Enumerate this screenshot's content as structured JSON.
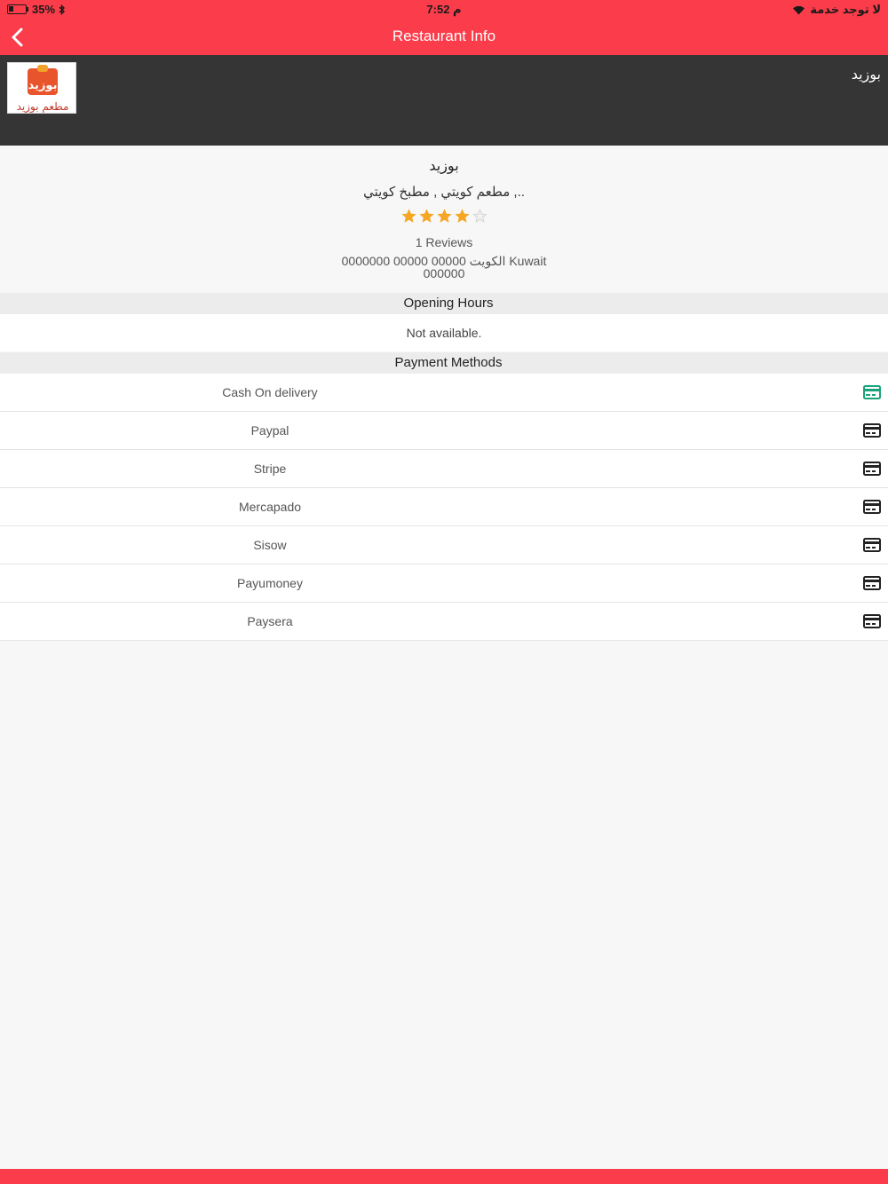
{
  "status_bar": {
    "battery": "35%",
    "time": "7:52 م",
    "carrier": "لا توجد خدمة"
  },
  "nav": {
    "title": "Restaurant Info",
    "back_icon": "chevron-left-icon"
  },
  "banner": {
    "name": "بوزيد",
    "logo_text": "مطعم بوزيد",
    "logo_mark": "بوزيد"
  },
  "restaurant": {
    "name": "بوزيد",
    "cuisine": "مطعم كويتي , مطبخ كويتي ,..",
    "rating": 4,
    "rating_max": 5,
    "reviews": "1 Reviews",
    "address": "0000000 00000 00000 الكويت Kuwait 000000"
  },
  "opening_hours": {
    "heading": "Opening Hours",
    "value": "Not available."
  },
  "payment_methods": {
    "heading": "Payment Methods",
    "items": [
      {
        "label": "Cash On delivery",
        "icon": "credit-card-icon",
        "color": "#1aa37a"
      },
      {
        "label": "Paypal",
        "icon": "credit-card-icon",
        "color": "#222222"
      },
      {
        "label": "Stripe",
        "icon": "credit-card-icon",
        "color": "#222222"
      },
      {
        "label": "Mercapado",
        "icon": "credit-card-icon",
        "color": "#222222"
      },
      {
        "label": "Sisow",
        "icon": "credit-card-icon",
        "color": "#222222"
      },
      {
        "label": "Payumoney",
        "icon": "credit-card-icon",
        "color": "#222222"
      },
      {
        "label": "Paysera",
        "icon": "credit-card-icon",
        "color": "#222222"
      }
    ]
  },
  "colors": {
    "brand": "#fb3c4a",
    "banner": "#353535",
    "star_on": "#f5a623",
    "star_off": "#d0d0d0"
  }
}
